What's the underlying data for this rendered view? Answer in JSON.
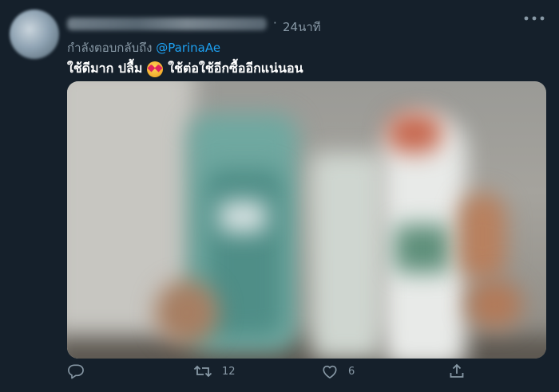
{
  "tweet": {
    "time": "24นาที",
    "separator": "·",
    "reply_prefix": "กำลังตอบกลับถึง",
    "reply_to": "@ParinaAe",
    "text_part1": "ใช้ดีมาก ปลื้ม",
    "emoji": "smiling-face-with-hearts",
    "text_part2": "ใช้ต่อใช้อีกซื้ออีกแน่นอน",
    "retweet_count": "12",
    "like_count": "6"
  },
  "icons": {
    "more": "more-icon",
    "reply": "reply-icon",
    "retweet": "retweet-icon",
    "like": "heart-icon",
    "share": "share-icon"
  },
  "colors": {
    "background": "#15202b",
    "secondary_text": "#8899a6",
    "link": "#1da1f2"
  }
}
